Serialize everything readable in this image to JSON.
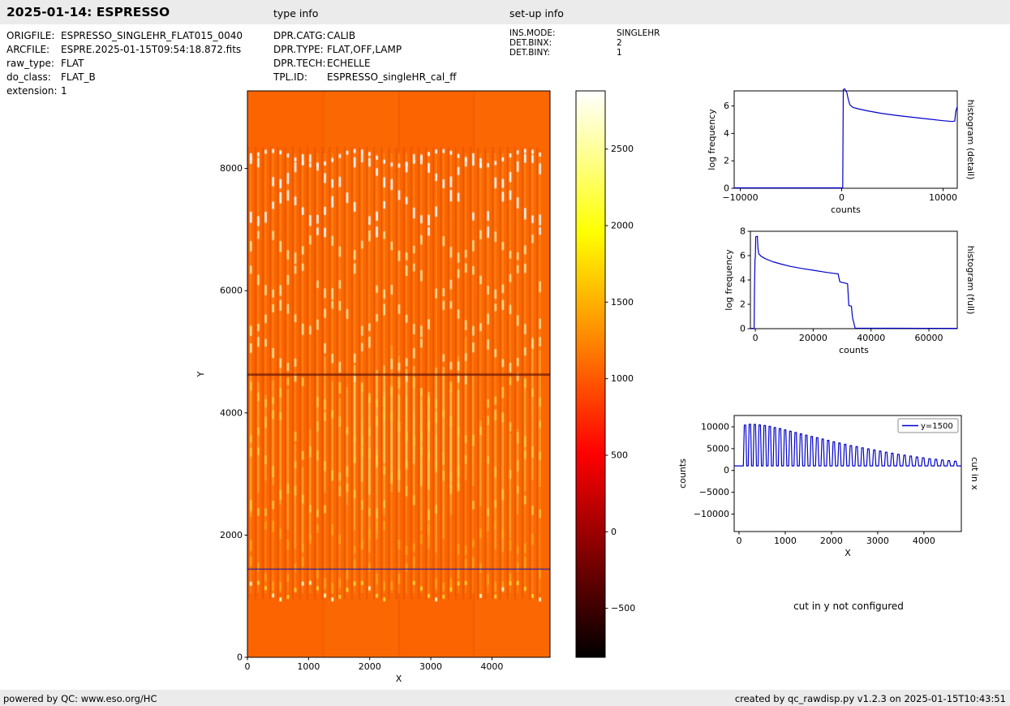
{
  "header": {
    "title": "2025-01-14: ESPRESSO",
    "type_info_label": "type info",
    "setup_info_label": "set-up info"
  },
  "file_info": {
    "rows": [
      {
        "label": "ORIGFILE:",
        "value": "ESPRESSO_SINGLEHR_FLAT015_0040"
      },
      {
        "label": "ARCFILE:",
        "value": "ESPRE.2025-01-15T09:54:18.872.fits"
      },
      {
        "label": "raw_type:",
        "value": "FLAT"
      },
      {
        "label": "do_class:",
        "value": "FLAT_B"
      },
      {
        "label": "extension:",
        "value": "1"
      }
    ]
  },
  "type_info": {
    "rows": [
      {
        "label": "DPR.CATG:",
        "value": "CALIB"
      },
      {
        "label": "DPR.TYPE:",
        "value": "FLAT,OFF,LAMP"
      },
      {
        "label": "DPR.TECH:",
        "value": "ECHELLE"
      },
      {
        "label": "TPL.ID:",
        "value": "ESPRESSO_singleHR_cal_ff"
      }
    ]
  },
  "setup_info": {
    "rows": [
      {
        "label": "INS.MODE:",
        "value": "SINGLEHR"
      },
      {
        "label": "DET.BINX:",
        "value": "2"
      },
      {
        "label": "DET.BINY:",
        "value": "1"
      }
    ]
  },
  "messages": {
    "cut_in_y": "cut in y not configured"
  },
  "footer": {
    "left": "powered by QC: www.eso.org/HC",
    "right": "created by qc_rawdisp.py v1.2.3 on 2025-01-15T10:43:51"
  },
  "colors": {
    "series_blue": "#0000cc",
    "cut_line_blue": "#2222aa",
    "image_background_orange": "#fb6400",
    "bar_background": "#ebebeb"
  },
  "chart_data": [
    {
      "name": "raw_image",
      "type": "heatmap",
      "description": "ESPRESSO echelle flat-field raw frame: vertical spectral orders (bright dashes forming arcs) on orange background, dark horizontal band near y=4630, blue cut line at y=1450",
      "xlabel": "X",
      "ylabel": "Y",
      "xticks": [
        0,
        1000,
        2000,
        3000,
        4000
      ],
      "yticks": [
        0,
        2000,
        4000,
        6000,
        8000
      ],
      "xlim": [
        0,
        4950
      ],
      "ylim": [
        0,
        9270
      ],
      "n_orders": 40,
      "cut_line_y": 1450,
      "dark_band_y": 4630,
      "colormap": "hot"
    },
    {
      "name": "colorbar",
      "type": "colorbar",
      "ticks": [
        2500,
        2000,
        1500,
        1000,
        500,
        0,
        -500
      ],
      "vmin": -820,
      "vmax": 2880,
      "colormap": "hot"
    },
    {
      "name": "histogram_detail",
      "type": "line",
      "right_label": "histogram (detail)",
      "xlabel": "counts",
      "ylabel": "log frequency",
      "xticks": [
        -10000,
        0,
        10000
      ],
      "yticks": [
        0,
        2,
        4,
        6
      ],
      "xlim": [
        -10600,
        11400
      ],
      "ylim": [
        0,
        7.1
      ],
      "x": [
        -10600,
        100,
        160,
        300,
        500,
        650,
        800,
        1100,
        1600,
        2500,
        4000,
        5500,
        7000,
        8500,
        10000,
        10900,
        11150,
        11250,
        11400
      ],
      "y": [
        0.03,
        0.03,
        7.2,
        7.25,
        7.0,
        6.5,
        6.1,
        5.9,
        5.8,
        5.65,
        5.45,
        5.3,
        5.18,
        5.05,
        4.93,
        4.87,
        4.9,
        5.6,
        5.95
      ]
    },
    {
      "name": "histogram_full",
      "type": "line",
      "right_label": "histogram (full)",
      "xlabel": "counts",
      "ylabel": "log frequency",
      "xticks": [
        0,
        20000,
        40000,
        60000
      ],
      "yticks": [
        0,
        2,
        4,
        6,
        8
      ],
      "xlim": [
        -1700,
        69800
      ],
      "ylim": [
        0,
        8
      ],
      "x": [
        -1700,
        -400,
        -300,
        -100,
        0,
        150,
        700,
        900,
        1200,
        2000,
        3500,
        6000,
        9000,
        12000,
        16000,
        20000,
        24000,
        27000,
        28600,
        29200,
        31400,
        31900,
        32300,
        33200,
        33600,
        34500,
        69800
      ],
      "y": [
        0.03,
        0.03,
        3.2,
        5.7,
        5.9,
        7.55,
        7.6,
        6.6,
        6.15,
        5.95,
        5.75,
        5.5,
        5.3,
        5.12,
        4.95,
        4.8,
        4.65,
        4.55,
        4.5,
        3.85,
        3.72,
        3.68,
        1.9,
        1.85,
        0.9,
        0.04,
        0.03
      ]
    },
    {
      "name": "cut_in_x",
      "type": "line",
      "right_label": "cut in x",
      "legend": [
        "y=1500"
      ],
      "xlabel": "X",
      "ylabel": "counts",
      "xticks": [
        0,
        1000,
        2000,
        3000,
        4000
      ],
      "yticks": [
        -10000,
        -5000,
        0,
        5000,
        10000
      ],
      "xlim": [
        -105,
        4810
      ],
      "ylim": [
        -14000,
        12600
      ],
      "baseline": 1050,
      "spike_x": [
        130,
        235,
        341,
        448,
        556,
        665,
        775,
        886,
        998,
        1111,
        1225,
        1340,
        1456,
        1573,
        1691,
        1810,
        1930,
        2051,
        2173,
        2296,
        2420,
        2545,
        2671,
        2798,
        2926,
        3055,
        3185,
        3316,
        3448,
        3581,
        3715,
        3850,
        3986,
        4123,
        4261,
        4400,
        4540,
        4681
      ],
      "spike_height": [
        10400,
        10600,
        10550,
        10450,
        10300,
        10100,
        9850,
        9600,
        9300,
        9000,
        8700,
        8400,
        8100,
        7800,
        7500,
        7200,
        6900,
        6600,
        6300,
        6000,
        5700,
        5450,
        5200,
        4950,
        4700,
        4450,
        4200,
        3950,
        3700,
        3500,
        3300,
        3100,
        2900,
        2700,
        2550,
        2400,
        2250,
        2100
      ]
    }
  ]
}
